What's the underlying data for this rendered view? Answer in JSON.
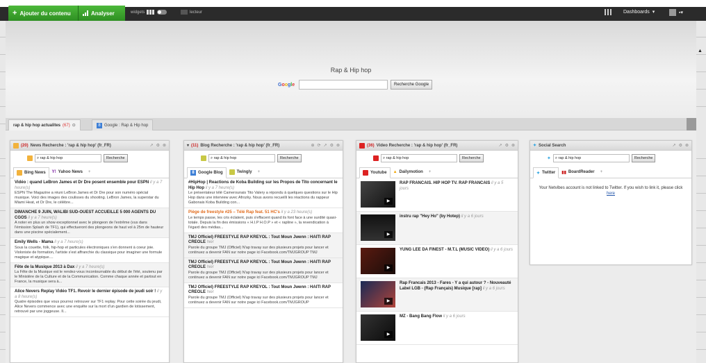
{
  "topbar": {
    "add_content": "Ajouter du contenu",
    "analyse": "Analyser",
    "widgets": "widgets",
    "lecteur": "lecteur",
    "dashboards": "Dashboards"
  },
  "header": {
    "page_title": "Rap & Hip hop",
    "search_logo": "Google",
    "search_button": "Recherche Google",
    "search_value": ""
  },
  "tabs": [
    {
      "label": "rap & hip hop actualites",
      "count": "(67)"
    },
    {
      "label": "Google : Rap & Hip hop"
    }
  ],
  "widgets": {
    "news": {
      "count": "(20)",
      "title": "News Recherche : 'rap & hip hop' (fr_FR)",
      "query": "rap & hip hop",
      "search_button": "Recherche",
      "tabs": [
        "Bing News",
        "Yahoo News",
        "+"
      ],
      "items": [
        {
          "title": "Vidéo : quand LeBron James et Dr Dre posent ensemble pour ESPN",
          "meta": "il y a 7 heure(s)",
          "text": "ESPN The Magazine a réuni LeBron James et Dr Dre pour son numéro spécial musique. Voici des images des coulisses du shooting. LeBron James, la superstar du Miami Heat, et Dr Dre, le célèbre..."
        },
        {
          "title": "DIMANCHE 9 JUIN, WALIBI SUD-OUEST ACCUEILLE 5 000 AGENTS DU CGOS",
          "meta": "il y a 7 heure(s)",
          "text": "A noter en plus un show exceptionnel avec le plongeon de l'extrême (vus dans l'émission Splash de TF1), qui effectueront des plongeons de haut vol à 25m de hauteur dans une piscine spécialement..."
        },
        {
          "title": "Emily Wells - Mama",
          "meta": "il y a 7 heure(s)",
          "text": "Sous la couette, folk, hip-hop et particules électroniques s'en donnent à coeur joie. Violoniste de formation, l'artiste s'est affranchie du classique pour imaginer une formule magique et atypique...."
        },
        {
          "title": "Fête de la Musique 2013 à Dax",
          "meta": "il y a 7 heure(s)",
          "text": "La Fête de la Musique est le rendez-vous incontournable du début de l'été, soutenu par le Ministère de la Culture et de la Communication. Comme chaque année et partout en France, la musique sera à..."
        },
        {
          "title": "Alice Nevers Replay Vidéo TF1. Revoir le dernier épisode de jeudi soir !",
          "meta": "il y a 8 heure(s)",
          "text": "Quatre épisodes que vous pourrez retrouver sur TF1 replay. Pour cette soirée du jeudi, Alice Nevers commence avec une enquête sur la mort d'un gardien de lotissement, retrouvé par une joggeuse. Il..."
        }
      ]
    },
    "blog": {
      "count": "(11)",
      "title": "Blog Recherche : 'rap & hip hop' (fr_FR)",
      "query": "rap & hip hop",
      "search_button": "Recherche",
      "tabs": [
        "Google Blog",
        "Twingly",
        "+"
      ],
      "items": [
        {
          "title": "#HipHop | Reactions de Koba Building sur les Propos de Tito concernant le Hip Hop",
          "meta": "il y a 7 heure(s)",
          "text": "Le présentateur télé Camerounais Tito Valery a répondu à quelques questions sur le Hip Hop dans une interview avec Afrozky. Nous avons recueilli les réactions du rappeur Gabonais Koba Building con...",
          "orange": false,
          "shaded": false
        },
        {
          "title": "Piège de freestyle #25 – Télé Rap feat. 51 HC's",
          "meta": "il y a 23 heure(s)",
          "text": "Le temps passe, les cris éclatent, puis s'effacent quand ils font face à une surdité quasi-totale. Depuis la fin des émissions « H.I.P H.O.P » et « rapline », la revendication à l'égard des médias...",
          "orange": true,
          "shaded": false
        },
        {
          "title": "TMJ Officiel) FREESTYLE RAP KREYOL : Tout Moun Jwenn : HAITI RAP CREOLE",
          "meta": "hier",
          "text": "Parole du groupe TMJ (Officiel) N'ap travay sur des plusieurs projets pour lancer et continuez a devenir FAN sur notre page ici Facebook.com/TMJGROUP TMJ",
          "orange": false,
          "shaded": true
        },
        {
          "title": "TMJ Officiel) FREESTYLE RAP KREYOL : Tout Moun Jwenn : HAITI RAP CREOLE",
          "meta": "hier",
          "text": "Parole du groupe TMJ (Officiel) N'ap travay sur des plusieurs projets pour lancer et continuez a devenir FAN sur notre page ici Facebook.com/TMJGROUP TMJ",
          "orange": false,
          "shaded": true
        },
        {
          "title": "TMJ Officiel) FREESTYLE RAP KREYOL : Tout Moun Jwenn : HAITI RAP CREOLE",
          "meta": "hier",
          "text": "Parole du groupe TMJ (Officiel) N'ap travay sur des plusieurs projets pour lancer et continuez a devenir FAN sur notre page ici Facebook.com/TMJGROUP",
          "orange": false,
          "shaded": false
        }
      ]
    },
    "video": {
      "count": "(36)",
      "title": "Video Recherche : 'rap & hip hop' (fr_FR)",
      "query": "rap & hip hop",
      "search_button": "Recherche",
      "tabs": [
        "Youtube",
        "Dailymotion",
        "+"
      ],
      "items": [
        {
          "title": "RAP FRANCAIS. HIP HOP TV. RAP FRANCAIS",
          "meta": "il y a 5 jours"
        },
        {
          "title": "instru rap \"Hey Ho\" (by Hotep)",
          "meta": "il y a 6 jours"
        },
        {
          "title": "YUNG LEE DA FINEST - M.T.L (MUSIC VIDEO)",
          "meta": "il y a 6 jours"
        },
        {
          "title": "Rap Francais 2013 - Fares - Y a qui autour ? - Nouveauté Label LGB - (Rap Français) Musique [rap]",
          "meta": "il y a 6 jours"
        },
        {
          "title": "MZ - Bang Bang Flow",
          "meta": "il y a 6 jours"
        }
      ]
    },
    "social": {
      "title": "Social Search",
      "query": "rap & hip hop",
      "search_button": "Recherche",
      "tabs": [
        "Twitter",
        "BoardReader",
        "+"
      ],
      "message": "Your Netvibes account is not linked to Twitter. If you wish to link it, please click",
      "link": "here"
    }
  },
  "colors": {
    "accent_green": "#3aa52c",
    "topbar_dark": "#2b2b2b",
    "count_red": "#c22",
    "orange_title": "#e06a1a"
  }
}
